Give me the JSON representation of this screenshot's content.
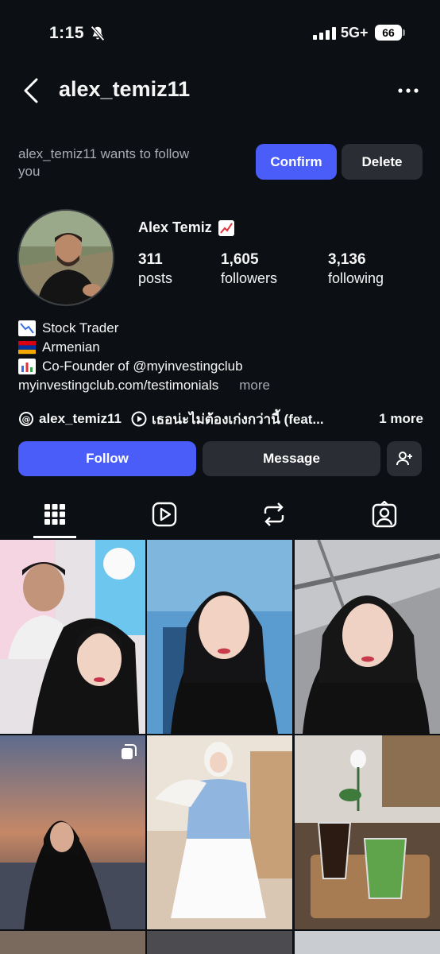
{
  "status_bar": {
    "time": "1:15",
    "network": "5G+",
    "battery": "66"
  },
  "header": {
    "username": "alex_temiz11"
  },
  "follow_request": {
    "text": "alex_temiz11 wants to follow you",
    "confirm_label": "Confirm",
    "delete_label": "Delete"
  },
  "profile": {
    "full_name": "Alex Temiz",
    "stats": [
      {
        "value": "311",
        "label": "posts"
      },
      {
        "value": "1,605",
        "label": "followers"
      },
      {
        "value": "3,136",
        "label": "following"
      }
    ],
    "bio": [
      {
        "icon": "chart-decreasing-emoji",
        "text": "Stock Trader"
      },
      {
        "icon": "armenia-flag-emoji",
        "text": "Armenian"
      },
      {
        "icon": "bar-chart-emoji",
        "text": "Co-Founder of @myinvestingclub"
      }
    ],
    "link": "myinvestingclub.com/testimonials",
    "more_label": "more",
    "threads_handle": "alex_temiz11",
    "music": "เธอน่ะไม่ต้องเก่งกว่านี้ (feat...",
    "links_more": "1 more"
  },
  "actions": {
    "follow_label": "Follow",
    "message_label": "Message"
  },
  "colors": {
    "background": "#0c0f14",
    "accent": "#4a5df9",
    "secondary_button": "#2a2d33",
    "muted_text": "#a8abb2"
  },
  "tabs": [
    "grid-icon",
    "reels-icon",
    "reposts-icon",
    "tagged-icon"
  ],
  "grid": [
    {
      "multi": false
    },
    {
      "multi": false
    },
    {
      "multi": false
    },
    {
      "multi": true
    },
    {
      "multi": false
    },
    {
      "multi": false
    }
  ]
}
